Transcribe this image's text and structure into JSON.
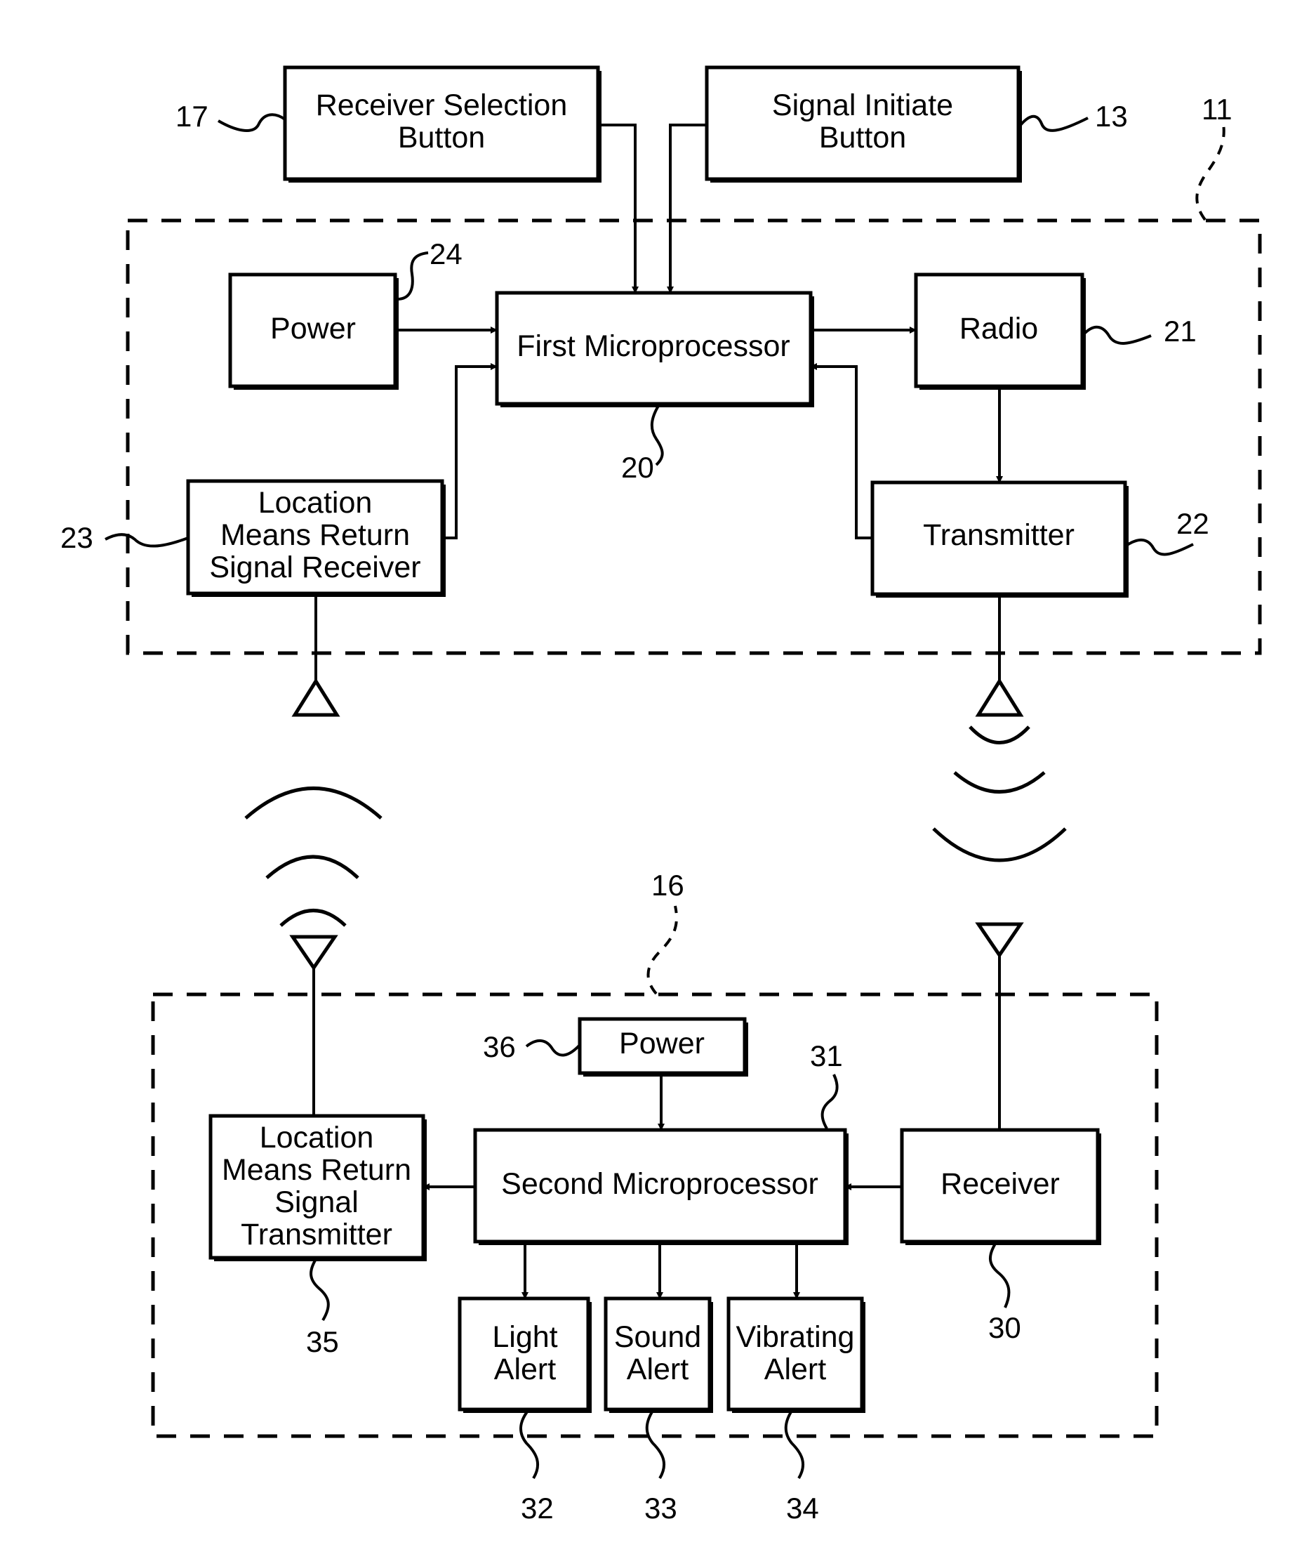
{
  "figure": {
    "type": "block-diagram",
    "colors": {
      "ink": "#000000",
      "background": "#ffffff"
    }
  },
  "external_inputs": {
    "receiver_selection": {
      "lines": [
        "Receiver Selection",
        "Button"
      ],
      "ref": "17"
    },
    "signal_initiate": {
      "lines": [
        "Signal Initiate",
        "Button"
      ],
      "ref": "13"
    }
  },
  "transmitter_unit": {
    "ref": "11",
    "power": {
      "lines": [
        "Power"
      ],
      "ref": "24"
    },
    "first_microprocessor": {
      "lines": [
        "First Microprocessor"
      ],
      "ref": "20"
    },
    "radio": {
      "lines": [
        "Radio"
      ],
      "ref": "21"
    },
    "transmitter": {
      "lines": [
        "Transmitter"
      ],
      "ref": "22"
    },
    "return_receiver": {
      "lines": [
        "Location",
        "Means Return",
        "Signal Receiver"
      ],
      "ref": "23"
    }
  },
  "receiver_unit": {
    "ref": "16",
    "power": {
      "lines": [
        "Power"
      ],
      "ref": "36"
    },
    "second_microprocessor": {
      "lines": [
        "Second Microprocessor"
      ],
      "ref": "31"
    },
    "receiver": {
      "lines": [
        "Receiver"
      ],
      "ref": "30"
    },
    "return_transmitter": {
      "lines": [
        "Location",
        "Means Return",
        "Signal",
        "Transmitter"
      ],
      "ref": "35"
    },
    "light_alert": {
      "lines": [
        "Light",
        "Alert"
      ],
      "ref": "32"
    },
    "sound_alert": {
      "lines": [
        "Sound",
        "Alert"
      ],
      "ref": "33"
    },
    "vibrating_alert": {
      "lines": [
        "Vibrating",
        "Alert"
      ],
      "ref": "34"
    }
  },
  "icons": {
    "antenna": "antenna-icon",
    "radio_waves": "radio-waves-icon",
    "arrow": "arrowhead-icon"
  }
}
